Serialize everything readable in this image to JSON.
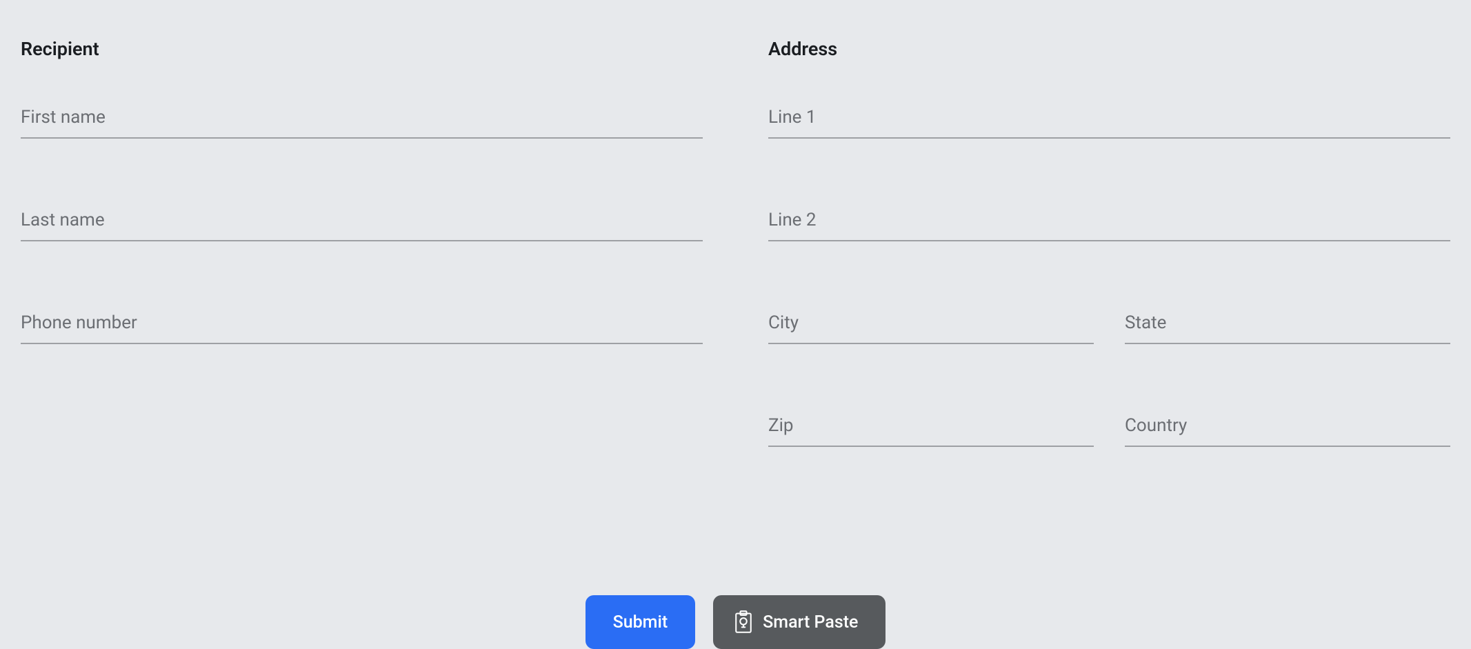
{
  "recipient": {
    "heading": "Recipient",
    "first_name": {
      "placeholder": "First name",
      "value": ""
    },
    "last_name": {
      "placeholder": "Last name",
      "value": ""
    },
    "phone": {
      "placeholder": "Phone number",
      "value": ""
    }
  },
  "address": {
    "heading": "Address",
    "line1": {
      "placeholder": "Line 1",
      "value": ""
    },
    "line2": {
      "placeholder": "Line 2",
      "value": ""
    },
    "city": {
      "placeholder": "City",
      "value": ""
    },
    "state": {
      "placeholder": "State",
      "value": ""
    },
    "zip": {
      "placeholder": "Zip",
      "value": ""
    },
    "country": {
      "placeholder": "Country",
      "value": ""
    }
  },
  "buttons": {
    "submit": "Submit",
    "smart_paste": "Smart Paste"
  }
}
